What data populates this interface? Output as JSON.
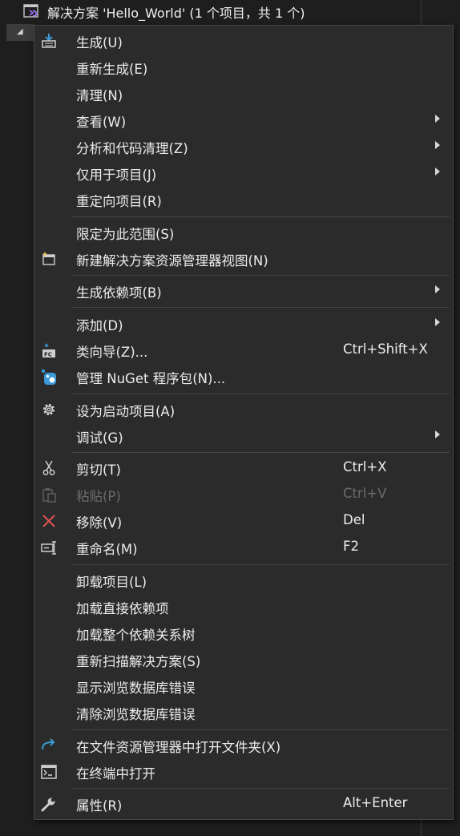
{
  "solution": {
    "title": "解决方案 'Hello_World' (1 个项目，共 1 个)"
  },
  "menu": {
    "items": [
      {
        "label": "生成(U)",
        "shortcut": "",
        "icon": "build-icon",
        "submenu": false
      },
      {
        "label": "重新生成(E)",
        "shortcut": "",
        "icon": "",
        "submenu": false
      },
      {
        "label": "清理(N)",
        "shortcut": "",
        "icon": "",
        "submenu": false
      },
      {
        "label": "查看(W)",
        "shortcut": "",
        "icon": "",
        "submenu": true
      },
      {
        "label": "分析和代码清理(Z)",
        "shortcut": "",
        "icon": "",
        "submenu": true
      },
      {
        "label": "仅用于项目(J)",
        "shortcut": "",
        "icon": "",
        "submenu": true
      },
      {
        "label": "重定向项目(R)",
        "shortcut": "",
        "icon": "",
        "submenu": false
      },
      {
        "label": "限定为此范围(S)",
        "shortcut": "",
        "icon": "",
        "submenu": false
      },
      {
        "label": "新建解决方案资源管理器视图(N)",
        "shortcut": "",
        "icon": "new-view-icon",
        "submenu": false
      },
      {
        "label": "生成依赖项(B)",
        "shortcut": "",
        "icon": "",
        "submenu": true
      },
      {
        "label": "添加(D)",
        "shortcut": "",
        "icon": "",
        "submenu": true
      },
      {
        "label": "类向导(Z)...",
        "shortcut": "Ctrl+Shift+X",
        "icon": "class-wizard-icon",
        "submenu": false
      },
      {
        "label": "管理 NuGet 程序包(N)...",
        "shortcut": "",
        "icon": "nuget-icon",
        "submenu": false
      },
      {
        "label": "设为启动项目(A)",
        "shortcut": "",
        "icon": "gear-icon",
        "submenu": false
      },
      {
        "label": "调试(G)",
        "shortcut": "",
        "icon": "",
        "submenu": true
      },
      {
        "label": "剪切(T)",
        "shortcut": "Ctrl+X",
        "icon": "scissors-icon",
        "submenu": false
      },
      {
        "label": "粘贴(P)",
        "shortcut": "Ctrl+V",
        "icon": "paste-icon",
        "submenu": false,
        "disabled": true
      },
      {
        "label": "移除(V)",
        "shortcut": "Del",
        "icon": "remove-icon",
        "submenu": false
      },
      {
        "label": "重命名(M)",
        "shortcut": "F2",
        "icon": "rename-icon",
        "submenu": false
      },
      {
        "label": "卸载项目(L)",
        "shortcut": "",
        "icon": "",
        "submenu": false
      },
      {
        "label": "加载直接依赖项",
        "shortcut": "",
        "icon": "",
        "submenu": false
      },
      {
        "label": "加载整个依赖关系树",
        "shortcut": "",
        "icon": "",
        "submenu": false
      },
      {
        "label": "重新扫描解决方案(S)",
        "shortcut": "",
        "icon": "",
        "submenu": false
      },
      {
        "label": "显示浏览数据库错误",
        "shortcut": "",
        "icon": "",
        "submenu": false
      },
      {
        "label": "清除浏览数据库错误",
        "shortcut": "",
        "icon": "",
        "submenu": false
      },
      {
        "label": "在文件资源管理器中打开文件夹(X)",
        "shortcut": "",
        "icon": "open-folder-arrow-icon",
        "submenu": false
      },
      {
        "label": "在终端中打开",
        "shortcut": "",
        "icon": "terminal-icon",
        "submenu": false
      },
      {
        "label": "属性(R)",
        "shortcut": "Alt+Enter",
        "icon": "wrench-icon",
        "submenu": false
      }
    ]
  },
  "colors": {
    "menu_bg": "#2b2b2b",
    "menu_border": "#454545",
    "separator": "#454545",
    "text": "#ececec",
    "disabled_text": "#6b6b6b",
    "remove_red": "#e05252",
    "accent_blue": "#3c9bd6",
    "vs_purple": "#a277ff"
  }
}
